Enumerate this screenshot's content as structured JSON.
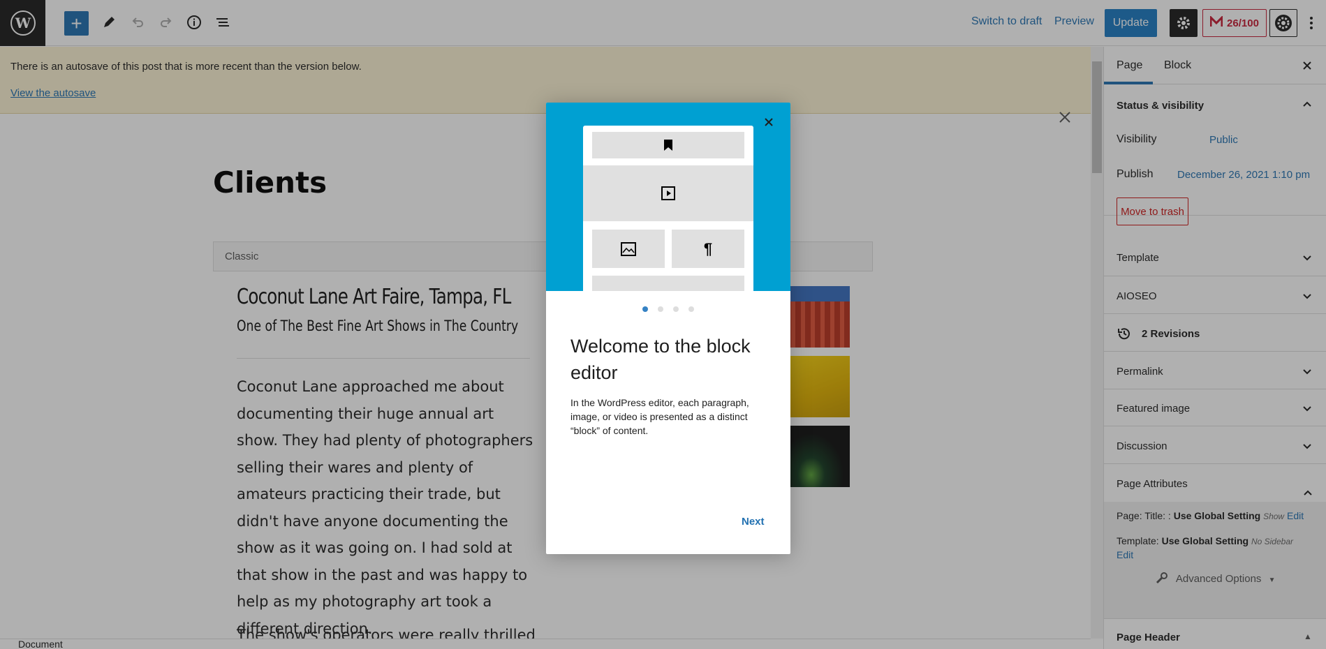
{
  "topbar": {
    "switch_draft": "Switch to draft",
    "preview": "Preview",
    "update": "Update",
    "seo_score": "26/100"
  },
  "notice": {
    "text": "There is an autosave of this post that is more recent than the version below.",
    "link": "View the autosave"
  },
  "content": {
    "title": "Clients",
    "classic_label": "Classic",
    "heading": "Coconut Lane Art Faire, Tampa, FL",
    "subheading": "One of The Best Fine Art Shows in The Country",
    "paragraph": "Coconut Lane approached me about documenting their huge annual art show. They had plenty of photographers selling their wares and plenty of amateurs practicing their trade, but didn't have anyone documenting the show as it was going on. I had sold at that show in the past and was happy to help as my photography art took a different direction.",
    "paragraph2": "The show's operators were really thrilled"
  },
  "statusbar": {
    "label": "Document"
  },
  "sidebar": {
    "tab_page": "Page",
    "tab_block": "Block",
    "status_title": "Status & visibility",
    "visibility_label": "Visibility",
    "visibility_value": "Public",
    "publish_label": "Publish",
    "publish_value": "December 26, 2021 1:10 pm",
    "trash": "Move to trash",
    "template": "Template",
    "aioseo": "AIOSEO",
    "revisions": "2 Revisions",
    "permalink": "Permalink",
    "featured": "Featured image",
    "discussion": "Discussion",
    "page_attributes": "Page Attributes",
    "attr_title_label": "Page: Title: :",
    "attr_title_value": "Use Global Setting",
    "attr_title_show": "Show",
    "attr_edit": "Edit",
    "attr_template_label": "Template:",
    "attr_template_value": "Use Global Setting",
    "attr_template_sub": "No Sidebar",
    "advanced": "Advanced Options",
    "page_header": "Page Header"
  },
  "modal": {
    "heading": "Welcome to the block editor",
    "body": "In the WordPress editor, each paragraph, image, or video is presented as a distinct “block” of content.",
    "next": "Next",
    "pages": 4,
    "current_page": 1
  },
  "colors": {
    "accent": "#2271b1",
    "hero": "#00a0d2",
    "notice": "#fcf3d4",
    "danger": "#cc1818"
  }
}
